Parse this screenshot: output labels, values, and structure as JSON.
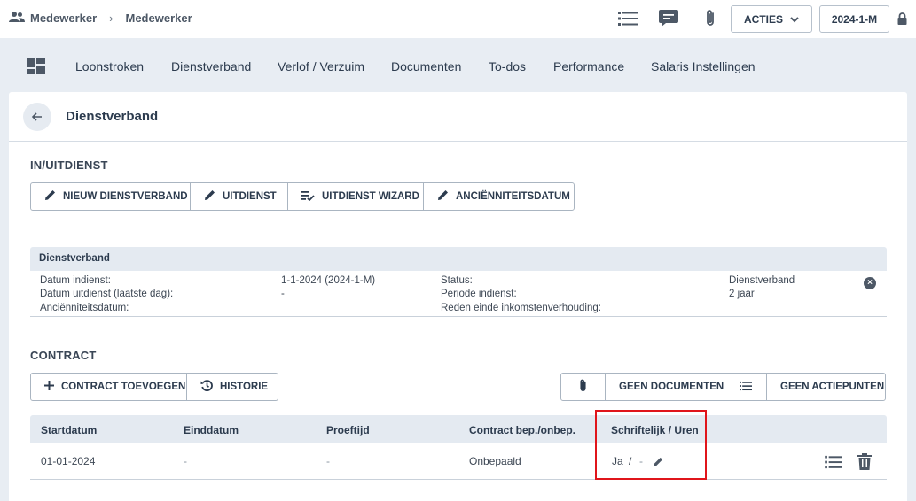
{
  "breadcrumb": {
    "root": "Medewerker",
    "current": "Medewerker"
  },
  "topbar": {
    "actions_label": "ACTIES",
    "period_label": "2024-1-M"
  },
  "nav": {
    "items": [
      "Loonstroken",
      "Dienstverband",
      "Verlof / Verzuim",
      "Documenten",
      "To-dos",
      "Performance",
      "Salaris Instellingen"
    ]
  },
  "page": {
    "title": "Dienstverband"
  },
  "inuitdienst": {
    "label": "IN/UITDIENST",
    "buttons": [
      "NIEUW DIENSTVERBAND",
      "UITDIENST",
      "UITDIENST WIZARD",
      "ANCIËNNITEITSDATUM"
    ]
  },
  "dienstverband": {
    "header": "Dienstverband",
    "left_labels": [
      "Datum indienst:",
      "Datum uitdienst (laatste dag):",
      "Anciënniteitsdatum:"
    ],
    "left_values": [
      "1-1-2024 (2024-1-M)",
      "-",
      ""
    ],
    "right_labels": [
      "Status:",
      "Periode indienst:",
      "Reden einde inkomstenverhouding:"
    ],
    "right_values": [
      "Dienstverband",
      "2 jaar",
      ""
    ]
  },
  "contract": {
    "label": "CONTRACT",
    "add_label": "CONTRACT TOEVOEGEN",
    "history_label": "HISTORIE",
    "documents_label": "GEEN DOCUMENTEN",
    "actions_label": "GEEN ACTIEPUNTEN",
    "columns": [
      "Startdatum",
      "Einddatum",
      "Proeftijd",
      "Contract bep./onbep.",
      "Schriftelijk / Uren"
    ],
    "rows": [
      {
        "start": "01-01-2024",
        "end": "-",
        "probation": "-",
        "type": "Onbepaald",
        "written": "Ja",
        "separator": "/",
        "hours": "-"
      }
    ]
  },
  "icons": {
    "breadcrumb": "users-icon",
    "list": "list-icon",
    "comment": "comment-icon",
    "attachment": "paperclip-icon",
    "lock": "lock-icon",
    "dashboard": "grid-icon",
    "back": "arrow-left-icon",
    "edit": "pencil-icon",
    "wizard": "checklist-icon",
    "add": "plus-icon",
    "history": "history-icon",
    "remove": "close-circle-icon",
    "delete": "trash-icon"
  },
  "colors": {
    "highlight": "#e0151b",
    "background": "#e8edf3",
    "table_header": "#e4eaf1"
  }
}
